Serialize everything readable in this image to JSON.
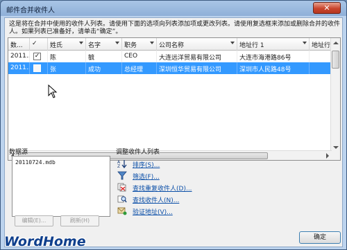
{
  "window": {
    "title": "邮件合并收件人",
    "close_label": "✕"
  },
  "instructions": "这是将在合并中使用的收件人列表。请使用下面的选项向列表添加项或更改列表。请使用复选框来添加或删除合并的收件人。如果列表已准备好，请单击“确定”。",
  "table": {
    "columns": [
      {
        "label": "数..."
      },
      {
        "label": "✓"
      },
      {
        "label": "姓氏"
      },
      {
        "label": "名字"
      },
      {
        "label": "职务"
      },
      {
        "label": "公司名称"
      },
      {
        "label": "地址行 1"
      },
      {
        "label": "地址行"
      }
    ],
    "rows": [
      {
        "source": "2011...",
        "checked": true,
        "last_name": "陈",
        "first_name": "毓",
        "title": "CEO",
        "company": "大连远洋贸易有限公司",
        "address": "大连市海港路86号",
        "selected": false
      },
      {
        "source": "2011...",
        "checked": false,
        "last_name": "张",
        "first_name": "成功",
        "title": "总经理",
        "company": "深圳恒华贸易有限公司",
        "address": "深圳市人民路48号",
        "selected": true
      }
    ]
  },
  "data_source": {
    "label": "数据源",
    "items": [
      "20110724.mdb"
    ],
    "edit_button": "编辑(E)...",
    "refresh_button": "刷新(H)"
  },
  "refine": {
    "label": "调整收件人列表",
    "links": [
      {
        "label": "排序(S)...",
        "icon": "sort-icon"
      },
      {
        "label": "筛选(F)...",
        "icon": "filter-icon"
      },
      {
        "label": "查找重复收件人(D)...",
        "icon": "duplicates-icon"
      },
      {
        "label": "查找收件人(N)...",
        "icon": "find-recipient-icon"
      },
      {
        "label": "验证地址(V)...",
        "icon": "validate-address-icon"
      }
    ]
  },
  "ok_button": "确定",
  "watermark": "WordHome"
}
